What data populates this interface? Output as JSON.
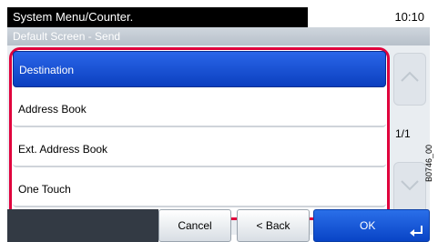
{
  "header": {
    "title": "System Menu/Counter.",
    "time": "10:10"
  },
  "subheader": {
    "title": "Default Screen - Send"
  },
  "list": {
    "items": [
      {
        "label": "Destination",
        "selected": true
      },
      {
        "label": "Address Book",
        "selected": false
      },
      {
        "label": "Ext. Address Book",
        "selected": false
      },
      {
        "label": "One Touch",
        "selected": false
      }
    ]
  },
  "pagination": {
    "indicator": "1/1"
  },
  "footer": {
    "cancel_label": "Cancel",
    "back_label": "< Back",
    "ok_label": "OK"
  },
  "figure_code": "B0746_00",
  "colors": {
    "highlight": "#e0003c",
    "selected": "#1e52d8"
  }
}
